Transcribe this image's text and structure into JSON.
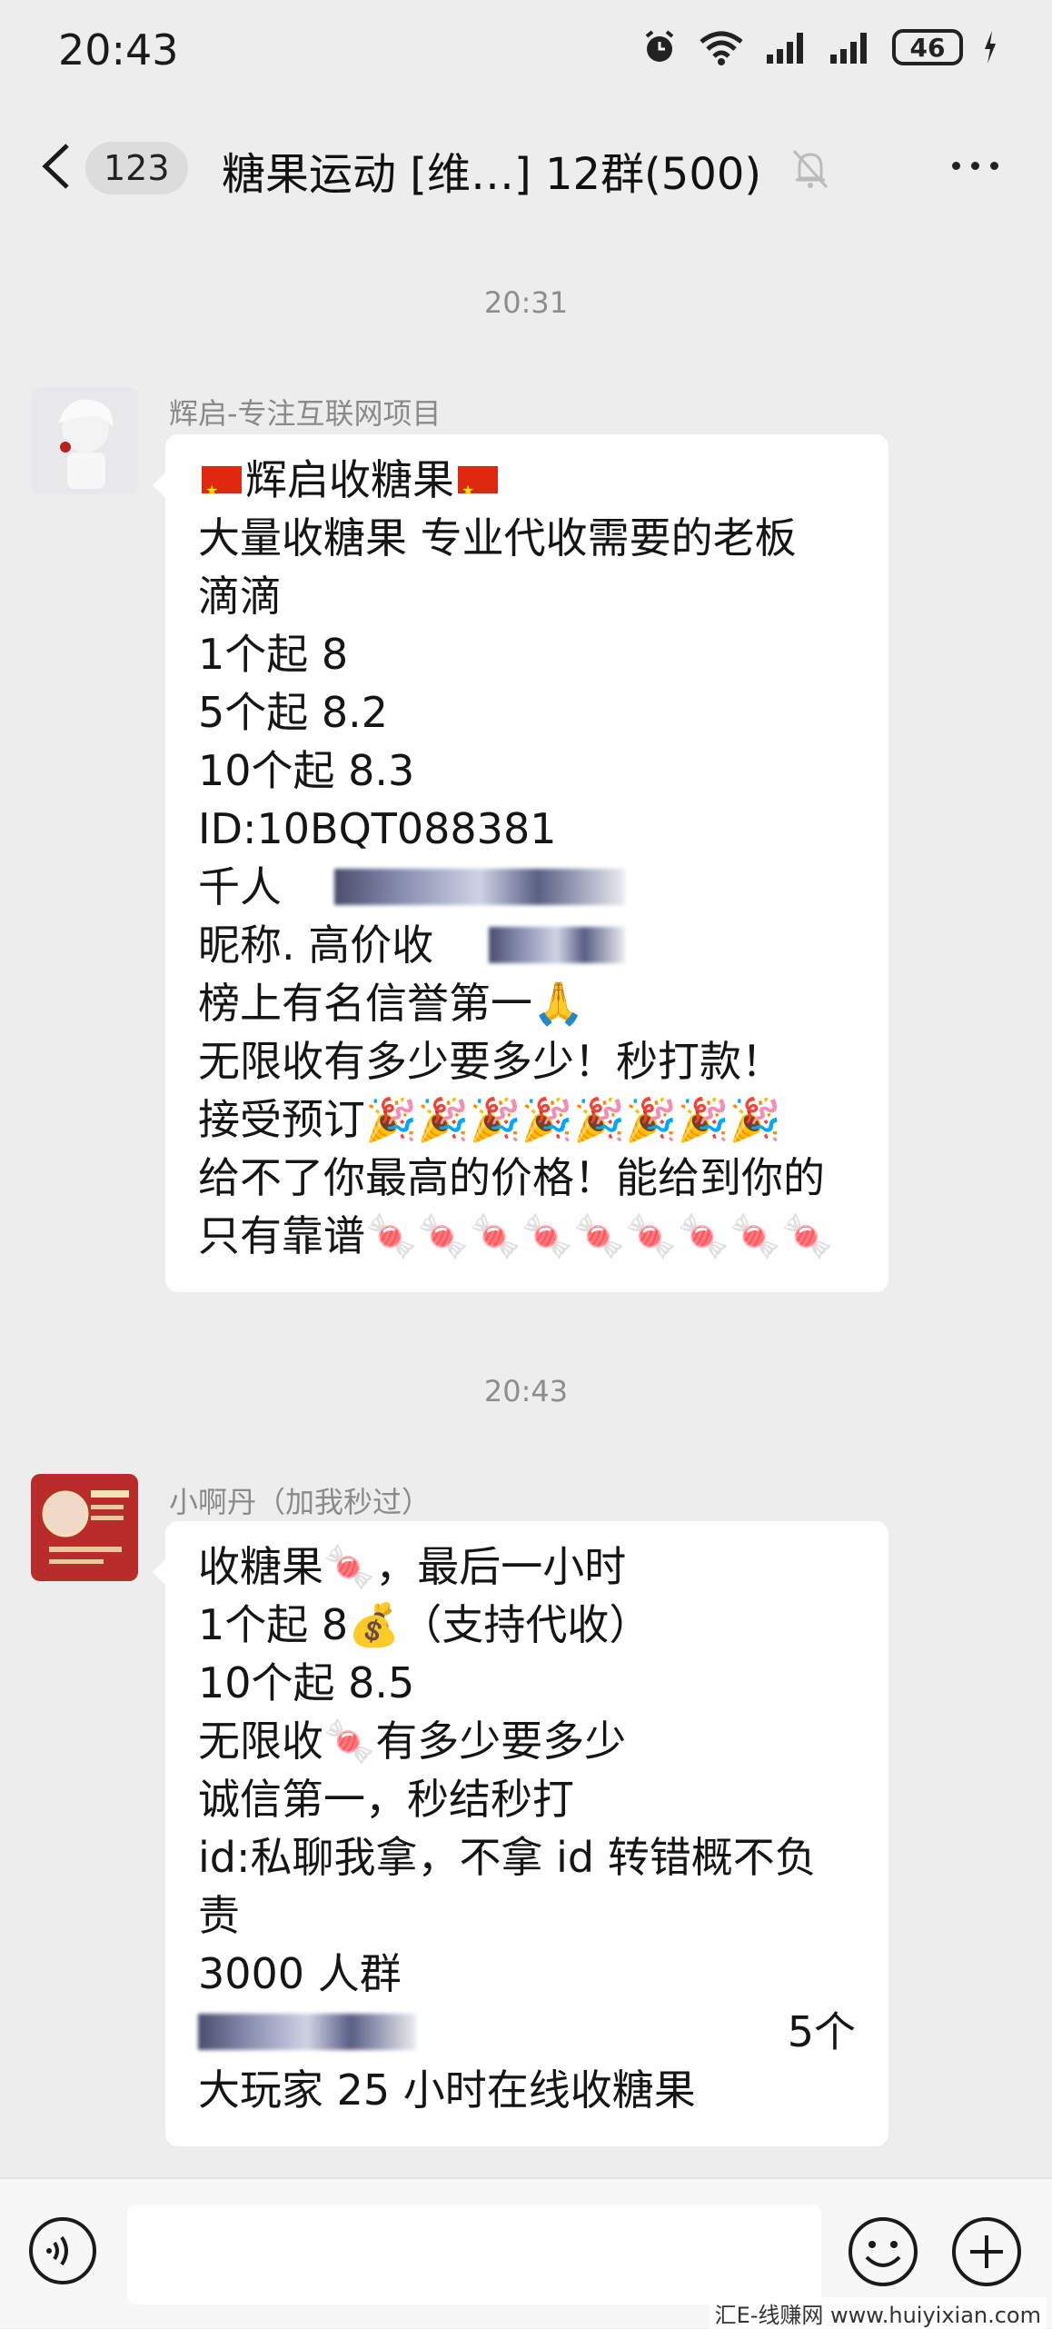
{
  "status_bar": {
    "time": "20:43",
    "battery": "46"
  },
  "header": {
    "unread_count": "123",
    "title": "糖果运动 [维…] 12群(500)"
  },
  "messages": [
    {
      "timestamp": "20:31",
      "sender": "辉启-专注互联网项目",
      "lines": [
        "辉启收糖果",
        "大量收糖果  专业代收需要的老板",
        "滴滴",
        "1个起 8",
        "5个起 8.2",
        "10个起 8.3",
        "ID:10BQT088381",
        "千人",
        "昵称.  高价收",
        "榜上有名信誉第一",
        "无限收有多少要多少！秒打款！",
        "接受预订🎉🎉🎉🎉🎉🎉🎉🎉",
        "给不了你最高的价格！能给到你的",
        "只有靠谱🍬🍬🍬🍬🍬🍬🍬🍬🍬"
      ]
    },
    {
      "timestamp": "20:43",
      "sender": "小啊丹（加我秒过）",
      "lines": [
        "收糖果🍬，最后一小时",
        "1个起 8💰（支持代收）",
        "10个起 8.5",
        "无限收🍬有多少要多少",
        "诚信第一，秒结秒打",
        "id:私聊我拿，不拿 id 转错概不负",
        "责",
        "3000 人群",
        "",
        "大玩家 25 小时在线收糖果"
      ],
      "line_9_right": "5个"
    }
  ],
  "watermark": "汇E-线赚网 www.huiyixian.com"
}
